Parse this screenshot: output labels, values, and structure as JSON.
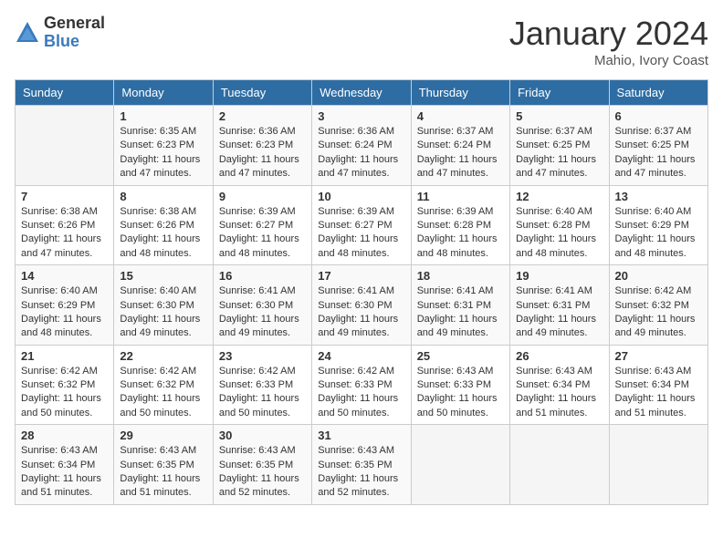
{
  "logo": {
    "general": "General",
    "blue": "Blue"
  },
  "title": "January 2024",
  "location": "Mahio, Ivory Coast",
  "days_of_week": [
    "Sunday",
    "Monday",
    "Tuesday",
    "Wednesday",
    "Thursday",
    "Friday",
    "Saturday"
  ],
  "weeks": [
    [
      {
        "day": "",
        "empty": true
      },
      {
        "day": "1",
        "sunrise": "6:35 AM",
        "sunset": "6:23 PM",
        "daylight": "11 hours and 47 minutes."
      },
      {
        "day": "2",
        "sunrise": "6:36 AM",
        "sunset": "6:23 PM",
        "daylight": "11 hours and 47 minutes."
      },
      {
        "day": "3",
        "sunrise": "6:36 AM",
        "sunset": "6:24 PM",
        "daylight": "11 hours and 47 minutes."
      },
      {
        "day": "4",
        "sunrise": "6:37 AM",
        "sunset": "6:24 PM",
        "daylight": "11 hours and 47 minutes."
      },
      {
        "day": "5",
        "sunrise": "6:37 AM",
        "sunset": "6:25 PM",
        "daylight": "11 hours and 47 minutes."
      },
      {
        "day": "6",
        "sunrise": "6:37 AM",
        "sunset": "6:25 PM",
        "daylight": "11 hours and 47 minutes."
      }
    ],
    [
      {
        "day": "7",
        "sunrise": "6:38 AM",
        "sunset": "6:26 PM",
        "daylight": "11 hours and 47 minutes."
      },
      {
        "day": "8",
        "sunrise": "6:38 AM",
        "sunset": "6:26 PM",
        "daylight": "11 hours and 48 minutes."
      },
      {
        "day": "9",
        "sunrise": "6:39 AM",
        "sunset": "6:27 PM",
        "daylight": "11 hours and 48 minutes."
      },
      {
        "day": "10",
        "sunrise": "6:39 AM",
        "sunset": "6:27 PM",
        "daylight": "11 hours and 48 minutes."
      },
      {
        "day": "11",
        "sunrise": "6:39 AM",
        "sunset": "6:28 PM",
        "daylight": "11 hours and 48 minutes."
      },
      {
        "day": "12",
        "sunrise": "6:40 AM",
        "sunset": "6:28 PM",
        "daylight": "11 hours and 48 minutes."
      },
      {
        "day": "13",
        "sunrise": "6:40 AM",
        "sunset": "6:29 PM",
        "daylight": "11 hours and 48 minutes."
      }
    ],
    [
      {
        "day": "14",
        "sunrise": "6:40 AM",
        "sunset": "6:29 PM",
        "daylight": "11 hours and 48 minutes."
      },
      {
        "day": "15",
        "sunrise": "6:40 AM",
        "sunset": "6:30 PM",
        "daylight": "11 hours and 49 minutes."
      },
      {
        "day": "16",
        "sunrise": "6:41 AM",
        "sunset": "6:30 PM",
        "daylight": "11 hours and 49 minutes."
      },
      {
        "day": "17",
        "sunrise": "6:41 AM",
        "sunset": "6:30 PM",
        "daylight": "11 hours and 49 minutes."
      },
      {
        "day": "18",
        "sunrise": "6:41 AM",
        "sunset": "6:31 PM",
        "daylight": "11 hours and 49 minutes."
      },
      {
        "day": "19",
        "sunrise": "6:41 AM",
        "sunset": "6:31 PM",
        "daylight": "11 hours and 49 minutes."
      },
      {
        "day": "20",
        "sunrise": "6:42 AM",
        "sunset": "6:32 PM",
        "daylight": "11 hours and 49 minutes."
      }
    ],
    [
      {
        "day": "21",
        "sunrise": "6:42 AM",
        "sunset": "6:32 PM",
        "daylight": "11 hours and 50 minutes."
      },
      {
        "day": "22",
        "sunrise": "6:42 AM",
        "sunset": "6:32 PM",
        "daylight": "11 hours and 50 minutes."
      },
      {
        "day": "23",
        "sunrise": "6:42 AM",
        "sunset": "6:33 PM",
        "daylight": "11 hours and 50 minutes."
      },
      {
        "day": "24",
        "sunrise": "6:42 AM",
        "sunset": "6:33 PM",
        "daylight": "11 hours and 50 minutes."
      },
      {
        "day": "25",
        "sunrise": "6:43 AM",
        "sunset": "6:33 PM",
        "daylight": "11 hours and 50 minutes."
      },
      {
        "day": "26",
        "sunrise": "6:43 AM",
        "sunset": "6:34 PM",
        "daylight": "11 hours and 51 minutes."
      },
      {
        "day": "27",
        "sunrise": "6:43 AM",
        "sunset": "6:34 PM",
        "daylight": "11 hours and 51 minutes."
      }
    ],
    [
      {
        "day": "28",
        "sunrise": "6:43 AM",
        "sunset": "6:34 PM",
        "daylight": "11 hours and 51 minutes."
      },
      {
        "day": "29",
        "sunrise": "6:43 AM",
        "sunset": "6:35 PM",
        "daylight": "11 hours and 51 minutes."
      },
      {
        "day": "30",
        "sunrise": "6:43 AM",
        "sunset": "6:35 PM",
        "daylight": "11 hours and 52 minutes."
      },
      {
        "day": "31",
        "sunrise": "6:43 AM",
        "sunset": "6:35 PM",
        "daylight": "11 hours and 52 minutes."
      },
      {
        "day": "",
        "empty": true
      },
      {
        "day": "",
        "empty": true
      },
      {
        "day": "",
        "empty": true
      }
    ]
  ],
  "labels": {
    "sunrise": "Sunrise:",
    "sunset": "Sunset:",
    "daylight": "Daylight:"
  }
}
